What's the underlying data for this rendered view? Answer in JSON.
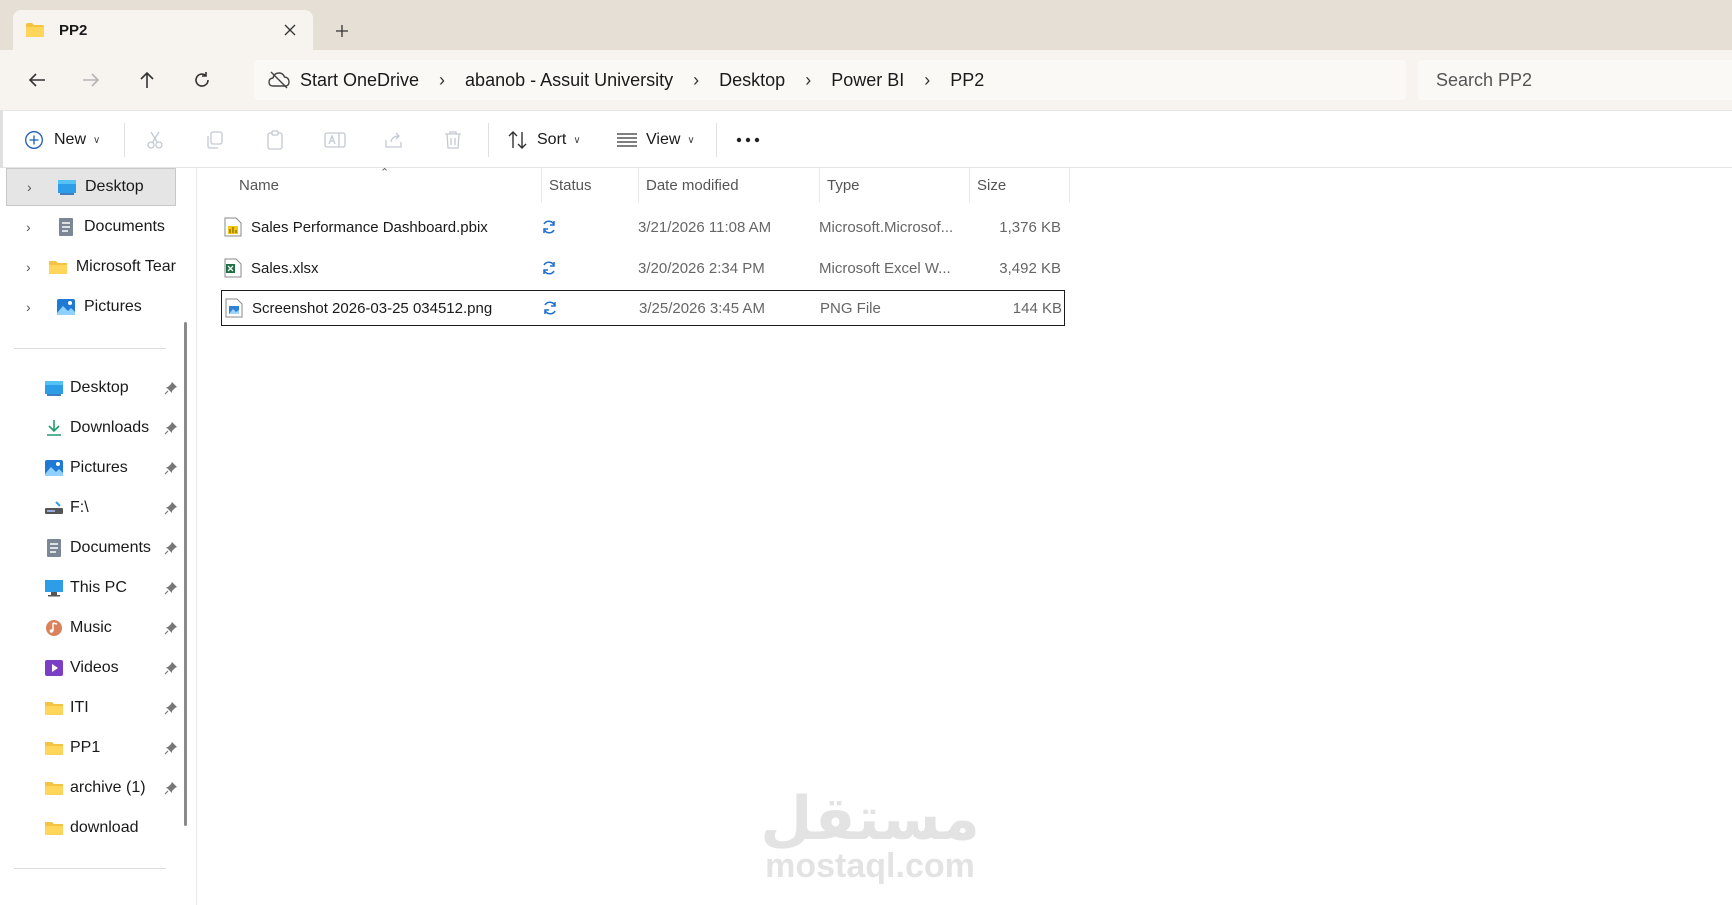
{
  "tab": {
    "title": "PP2",
    "close_icon": "close-icon",
    "new_tab_icon": "plus-icon"
  },
  "nav": {
    "breadcrumbs": [
      "Start OneDrive",
      "abanob - Assuit University",
      "Desktop",
      "Power BI",
      "PP2"
    ],
    "search_placeholder": "Search PP2"
  },
  "toolbar": {
    "new_label": "New",
    "sort_label": "Sort",
    "view_label": "View"
  },
  "sidebar": {
    "tree": [
      {
        "label": "Desktop",
        "icon": "desktop-icon",
        "selected": true
      },
      {
        "label": "Documents",
        "icon": "documents-icon"
      },
      {
        "label": "Microsoft Tear",
        "icon": "folder-icon"
      },
      {
        "label": "Pictures",
        "icon": "pictures-icon"
      }
    ],
    "quick_access": [
      {
        "label": "Desktop",
        "icon": "desktop-icon",
        "pinned": true
      },
      {
        "label": "Downloads",
        "icon": "downloads-icon",
        "pinned": true
      },
      {
        "label": "Pictures",
        "icon": "pictures-icon",
        "pinned": true
      },
      {
        "label": "F:\\",
        "icon": "drive-icon",
        "pinned": true
      },
      {
        "label": "Documents",
        "icon": "documents-icon",
        "pinned": true
      },
      {
        "label": "This PC",
        "icon": "this-pc-icon",
        "pinned": true
      },
      {
        "label": "Music",
        "icon": "music-icon",
        "pinned": true
      },
      {
        "label": "Videos",
        "icon": "videos-icon",
        "pinned": true
      },
      {
        "label": "ITI",
        "icon": "folder-icon",
        "pinned": true
      },
      {
        "label": "PP1",
        "icon": "folder-icon",
        "pinned": true
      },
      {
        "label": "archive (1)",
        "icon": "folder-icon",
        "pinned": true
      },
      {
        "label": "download",
        "icon": "folder-icon",
        "pinned": false
      }
    ]
  },
  "columns": {
    "name": "Name",
    "status": "Status",
    "date": "Date modified",
    "type": "Type",
    "size": "Size"
  },
  "files": [
    {
      "name": "Sales Performance Dashboard.pbix",
      "icon": "pbix-file-icon",
      "status": "sync-icon",
      "date": "3/21/2026 11:08 AM",
      "type": "Microsoft.Microsof...",
      "size": "1,376 KB"
    },
    {
      "name": "Sales.xlsx",
      "icon": "excel-file-icon",
      "status": "sync-icon",
      "date": "3/20/2026 2:34 PM",
      "type": "Microsoft Excel W...",
      "size": "3,492 KB"
    },
    {
      "name": "Screenshot 2026-03-25 034512.png",
      "icon": "image-file-icon",
      "status": "sync-icon",
      "date": "3/25/2026 3:45 AM",
      "type": "PNG File",
      "size": "144 KB"
    }
  ],
  "watermark": {
    "arabic": "مستقل",
    "latin": "mostaql.com"
  },
  "colors": {
    "folder": "#f5c342",
    "accent": "#0067c0",
    "sync": "#1f6fd1"
  }
}
